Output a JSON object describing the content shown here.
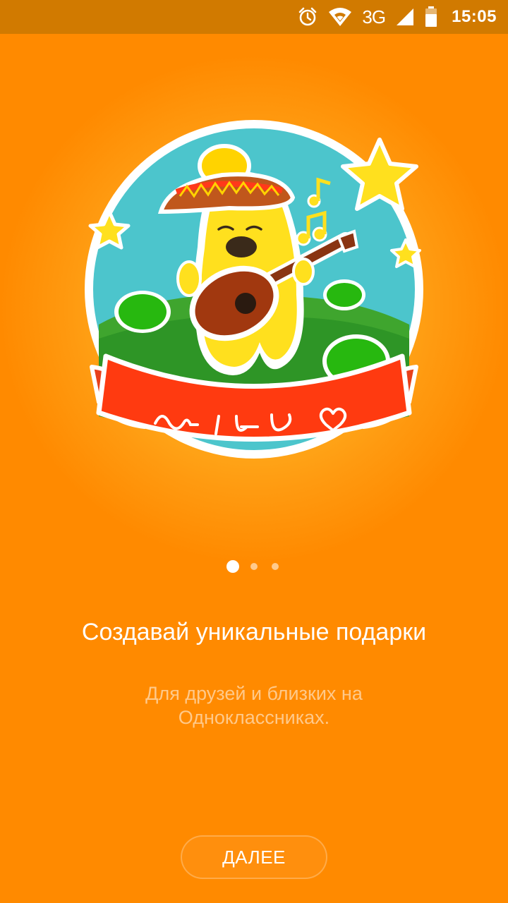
{
  "status_bar": {
    "network": "3G",
    "time": "15:05",
    "icons": [
      "alarm-icon",
      "wifi-icon",
      "signal-icon",
      "battery-icon"
    ]
  },
  "onboarding": {
    "title": "Создавай уникальные подарки",
    "subtitle": "Для друзей и близких на Одноклассниках.",
    "page_count": 3,
    "active_page": 1,
    "next_button_label": "ДАЛЕЕ"
  },
  "colors": {
    "background": "#FF8A00",
    "status_bar": "#D17A00",
    "text_primary": "#FFFFFF",
    "text_secondary": "#FFC98A"
  }
}
